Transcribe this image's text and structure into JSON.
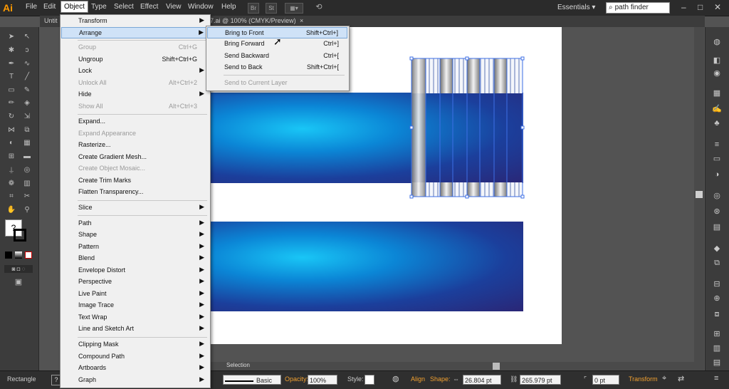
{
  "app": {
    "logo": "Ai"
  },
  "menubar": {
    "items": [
      "File",
      "Edit",
      "Object",
      "Type",
      "Select",
      "Effect",
      "View",
      "Window",
      "Help"
    ],
    "active": "Object",
    "buttons": [
      "Br",
      "St"
    ],
    "workspace": "Essentials",
    "search_value": "path finder"
  },
  "document": {
    "tab_left": "Untit",
    "tab_right": "7.ai @ 100% (CMYK/Preview)",
    "tab_close": "×"
  },
  "object_menu": {
    "items": [
      {
        "label": "Transform",
        "shortcut": "",
        "submenu": true,
        "disabled": false
      },
      {
        "label": "Arrange",
        "shortcut": "",
        "submenu": true,
        "disabled": false,
        "highlighted": true
      },
      {
        "label": "Group",
        "shortcut": "Ctrl+G",
        "submenu": false,
        "disabled": true
      },
      {
        "label": "Ungroup",
        "shortcut": "Shift+Ctrl+G",
        "submenu": false,
        "disabled": false
      },
      {
        "label": "Lock",
        "shortcut": "",
        "submenu": true,
        "disabled": false
      },
      {
        "label": "Unlock All",
        "shortcut": "Alt+Ctrl+2",
        "submenu": false,
        "disabled": true
      },
      {
        "label": "Hide",
        "shortcut": "",
        "submenu": true,
        "disabled": false
      },
      {
        "label": "Show All",
        "shortcut": "Alt+Ctrl+3",
        "submenu": false,
        "disabled": true
      },
      {
        "label": "Expand...",
        "shortcut": "",
        "submenu": false,
        "disabled": false
      },
      {
        "label": "Expand Appearance",
        "shortcut": "",
        "submenu": false,
        "disabled": true
      },
      {
        "label": "Rasterize...",
        "shortcut": "",
        "submenu": false,
        "disabled": false
      },
      {
        "label": "Create Gradient Mesh...",
        "shortcut": "",
        "submenu": false,
        "disabled": false
      },
      {
        "label": "Create Object Mosaic...",
        "shortcut": "",
        "submenu": false,
        "disabled": true
      },
      {
        "label": "Create Trim Marks",
        "shortcut": "",
        "submenu": false,
        "disabled": false
      },
      {
        "label": "Flatten Transparency...",
        "shortcut": "",
        "submenu": false,
        "disabled": false
      },
      {
        "label": "Slice",
        "shortcut": "",
        "submenu": true,
        "disabled": false
      },
      {
        "label": "Path",
        "shortcut": "",
        "submenu": true,
        "disabled": false
      },
      {
        "label": "Shape",
        "shortcut": "",
        "submenu": true,
        "disabled": false
      },
      {
        "label": "Pattern",
        "shortcut": "",
        "submenu": true,
        "disabled": false
      },
      {
        "label": "Blend",
        "shortcut": "",
        "submenu": true,
        "disabled": false
      },
      {
        "label": "Envelope Distort",
        "shortcut": "",
        "submenu": true,
        "disabled": false
      },
      {
        "label": "Perspective",
        "shortcut": "",
        "submenu": true,
        "disabled": false
      },
      {
        "label": "Live Paint",
        "shortcut": "",
        "submenu": true,
        "disabled": false
      },
      {
        "label": "Image Trace",
        "shortcut": "",
        "submenu": true,
        "disabled": false
      },
      {
        "label": "Text Wrap",
        "shortcut": "",
        "submenu": true,
        "disabled": false
      },
      {
        "label": "Line and Sketch Art",
        "shortcut": "",
        "submenu": true,
        "disabled": false
      },
      {
        "label": "Clipping Mask",
        "shortcut": "",
        "submenu": true,
        "disabled": false
      },
      {
        "label": "Compound Path",
        "shortcut": "",
        "submenu": true,
        "disabled": false
      },
      {
        "label": "Artboards",
        "shortcut": "",
        "submenu": true,
        "disabled": false
      },
      {
        "label": "Graph",
        "shortcut": "",
        "submenu": true,
        "disabled": false
      }
    ]
  },
  "arrange_submenu": {
    "items": [
      {
        "label": "Bring to Front",
        "shortcut": "Shift+Ctrl+]",
        "disabled": false,
        "highlighted": true
      },
      {
        "label": "Bring Forward",
        "shortcut": "Ctrl+]",
        "disabled": false
      },
      {
        "label": "Send Backward",
        "shortcut": "Ctrl+[",
        "disabled": false
      },
      {
        "label": "Send to Back",
        "shortcut": "Shift+Ctrl+[",
        "disabled": false
      },
      {
        "label": "Send to Current Layer",
        "shortcut": "",
        "disabled": true
      }
    ]
  },
  "statusbar": {
    "tool_name": "Selection"
  },
  "controlbar": {
    "object_type": "Rectangle",
    "stroke_style": "Basic",
    "opacity_label": "Opacity:",
    "opacity_value": "100%",
    "style_label": "Style:",
    "align_label": "Align",
    "shape_label": "Shape:",
    "width_value": "26.804 pt",
    "height_value": "265.979 pt",
    "corner_value": "0 pt",
    "transform_label": "Transform"
  },
  "colors": {
    "accent": "#ff9a00",
    "gradient_center": "#19c6f6",
    "gradient_edge": "#2a2676",
    "selection": "#3d6fe6"
  }
}
